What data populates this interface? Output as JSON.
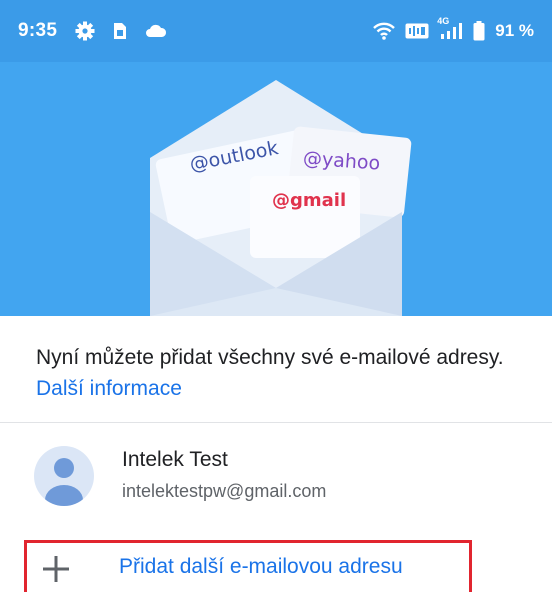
{
  "status_bar": {
    "time": "9:35",
    "network_label": "4G",
    "battery_percent": "91 %"
  },
  "hero": {
    "tags": {
      "outlook": "@outlook",
      "yahoo": "@yahoo",
      "gmail": "@gmail"
    }
  },
  "info": {
    "text": "Nyní můžete přidat všechny své e-mailové adresy.",
    "link": "Další informace"
  },
  "account": {
    "name": "Intelek Test",
    "email": "intelektestpw@gmail.com"
  },
  "add_account": {
    "label": "Přidat další e-mailovou adresu"
  },
  "colors": {
    "status_bar": "#3b9be8",
    "hero_background": "#42a5f0",
    "link": "#1a73e8",
    "highlight_border": "#e1252f"
  },
  "icons": [
    "settings-gear-icon",
    "sim-card-icon",
    "cloud-icon",
    "wifi-icon",
    "vowifi-icon",
    "signal-icon",
    "battery-icon",
    "avatar-person-icon",
    "plus-icon"
  ]
}
